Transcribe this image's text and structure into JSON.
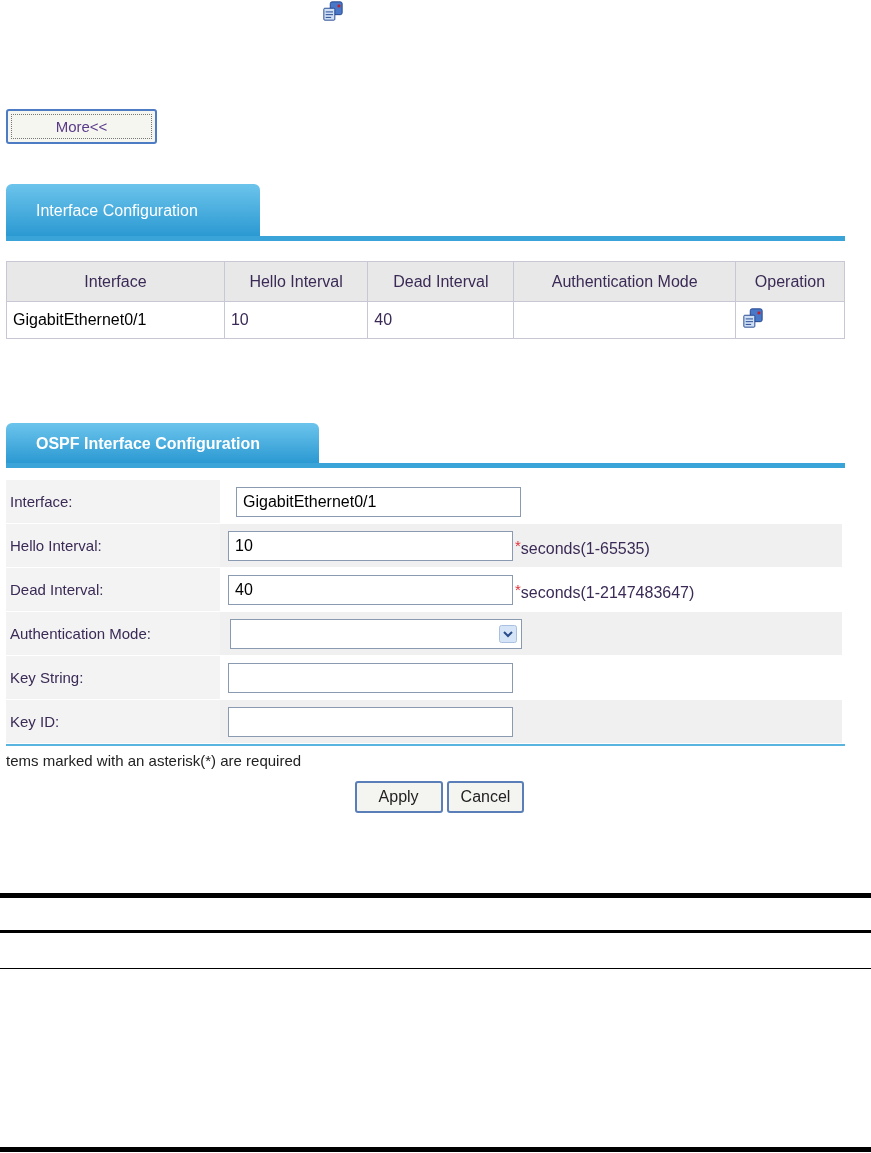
{
  "more_button": {
    "label": "More<<"
  },
  "interface_section": {
    "tab": {
      "label": "Interface Configuration",
      "selected": true
    },
    "table": {
      "columns": [
        "Interface",
        "Hello Interval",
        "Dead Interval",
        "Authentication Mode",
        "Operation"
      ],
      "rows": [
        {
          "interface": "GigabitEthernet0/1",
          "hello_interval": "10",
          "dead_interval": "40",
          "authentication_mode": ""
        }
      ]
    }
  },
  "ospf_section": {
    "tab": {
      "label": "OSPF Interface Configuration",
      "selected": true
    },
    "fields": [
      {
        "kind": "text",
        "label": "Interface:",
        "value": "GigabitEthernet0/1"
      },
      {
        "kind": "text",
        "label": "Hello Interval:",
        "value": "10",
        "asterisk": "*",
        "hint": "seconds(1-65535)"
      },
      {
        "kind": "text",
        "label": "Dead Interval:",
        "value": "40",
        "asterisk": "*",
        "hint": "seconds(1-2147483647)"
      },
      {
        "kind": "select",
        "label": "Authentication Mode:"
      },
      {
        "kind": "text",
        "label": "Key String:"
      },
      {
        "kind": "text",
        "label": "Key ID:"
      }
    ],
    "note": "tems marked with an asterisk(*) are required",
    "buttons": [
      "Apply",
      "Cancel"
    ]
  }
}
